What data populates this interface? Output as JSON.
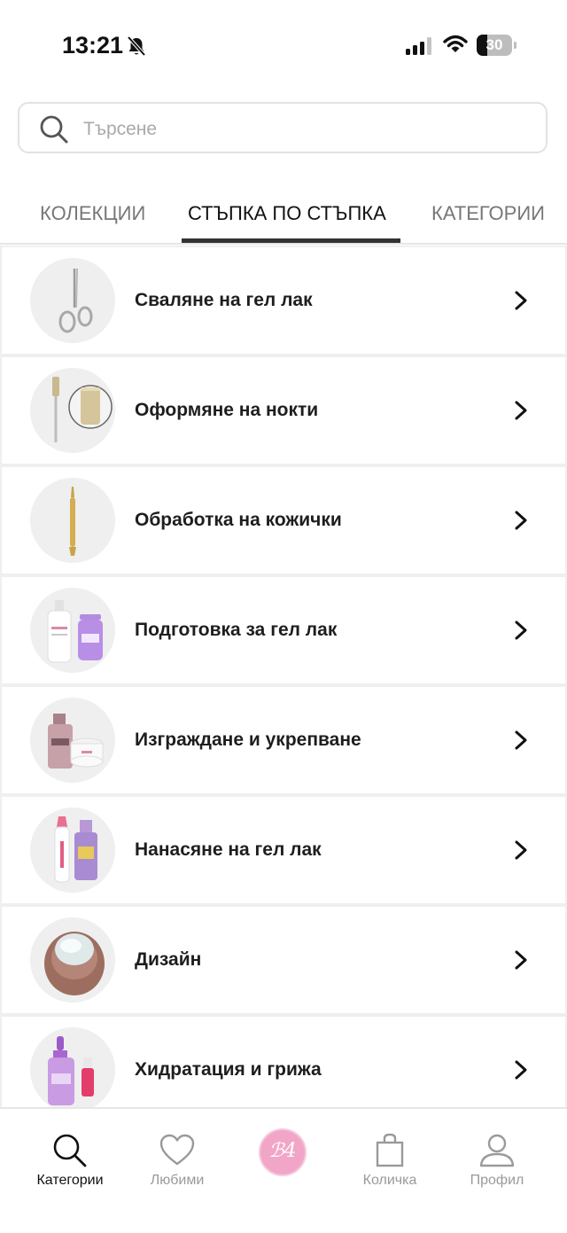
{
  "status": {
    "time": "13:21",
    "battery": "30",
    "battery_level": 0.3
  },
  "search": {
    "placeholder": "Търсене"
  },
  "tabs": [
    {
      "label": "КОЛЕКЦИИ",
      "active": false
    },
    {
      "label": "СТЪПКА ПО СТЪПКА",
      "active": true
    },
    {
      "label": "КАТЕГОРИИ",
      "active": false
    }
  ],
  "steps": [
    {
      "label": "Сваляне на гел лак",
      "icon": "scissors-icon"
    },
    {
      "label": "Оформяне на нокти",
      "icon": "nail-file-bits-icon"
    },
    {
      "label": "Обработка на кожички",
      "icon": "cuticle-pusher-icon"
    },
    {
      "label": "Подготовка за гел лак",
      "icon": "prep-liquids-icon"
    },
    {
      "label": "Изграждане и укрепване",
      "icon": "builder-gel-icon"
    },
    {
      "label": "Нанасяне на гел лак",
      "icon": "gel-polish-icon"
    },
    {
      "label": "Дизайн",
      "icon": "design-jar-icon"
    },
    {
      "label": "Хидратация и грижа",
      "icon": "care-oil-icon"
    }
  ],
  "bottom_nav": {
    "items": [
      {
        "label": "Категории",
        "icon": "search-icon",
        "active": true
      },
      {
        "label": "Любими",
        "icon": "heart-icon",
        "active": false
      },
      {
        "label": "Количка",
        "icon": "shopping-bag-icon",
        "active": false
      },
      {
        "label": "Профил",
        "icon": "user-icon",
        "active": false
      }
    ],
    "logo": {
      "icon": "brand-logo-icon",
      "text": "ℬ4"
    }
  },
  "colors": {
    "brand_pink": "#f2a6c7",
    "active_tab": "#333333",
    "inactive": "#9a9a9a"
  }
}
